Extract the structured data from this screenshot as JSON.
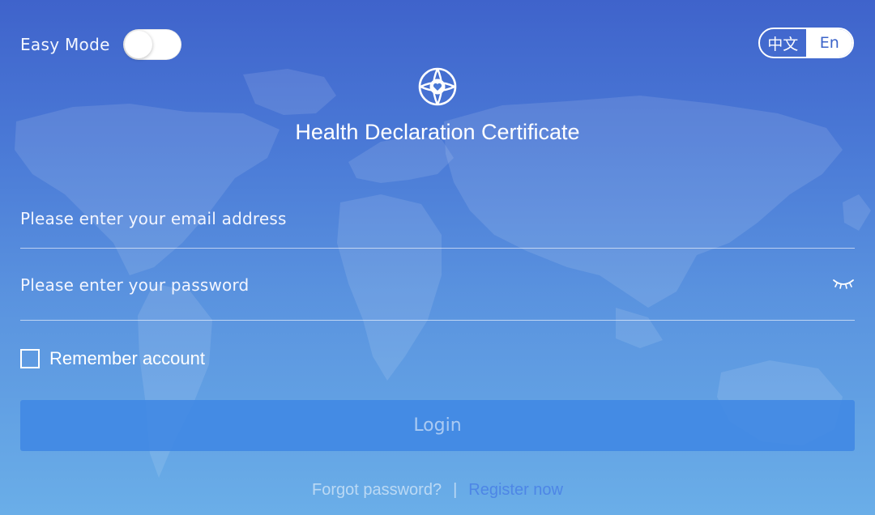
{
  "header": {
    "easy_mode_label": "Easy Mode",
    "easy_mode_on": false,
    "language_options": [
      {
        "label": "中文",
        "selected": false
      },
      {
        "label": "En",
        "selected": true
      }
    ]
  },
  "logo": {
    "icon": "globe-heart-icon"
  },
  "title": "Health Declaration Certificate",
  "form": {
    "email_placeholder": "Please enter your email address",
    "password_placeholder": "Please enter your password",
    "password_toggle_icon": "eye-closed-icon",
    "remember_label": "Remember account",
    "remember_checked": false,
    "login_label": "Login"
  },
  "footer": {
    "forgot_label": "Forgot password?",
    "separator": "|",
    "register_label": "Register now"
  },
  "colors": {
    "background_top": "#3f63cb",
    "background_bottom": "#6aaee8",
    "login_button": "#4088e4",
    "register_link": "#4d86e6"
  }
}
